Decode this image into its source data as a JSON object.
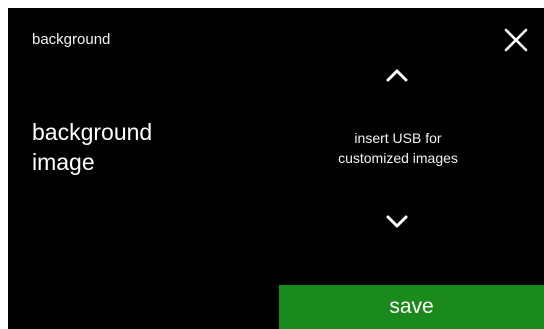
{
  "header": {
    "title": "background",
    "close_icon": "close-icon"
  },
  "setting": {
    "label_line1": "background",
    "label_line2": "image"
  },
  "selector": {
    "up_icon": "chevron-up-icon",
    "down_icon": "chevron-down-icon",
    "value_line1": "insert USB for",
    "value_line2": "customized images"
  },
  "footer": {
    "save_label": "save",
    "save_color": "#1a8a1c"
  },
  "colors": {
    "background": "#000000",
    "text": "#ffffff"
  }
}
